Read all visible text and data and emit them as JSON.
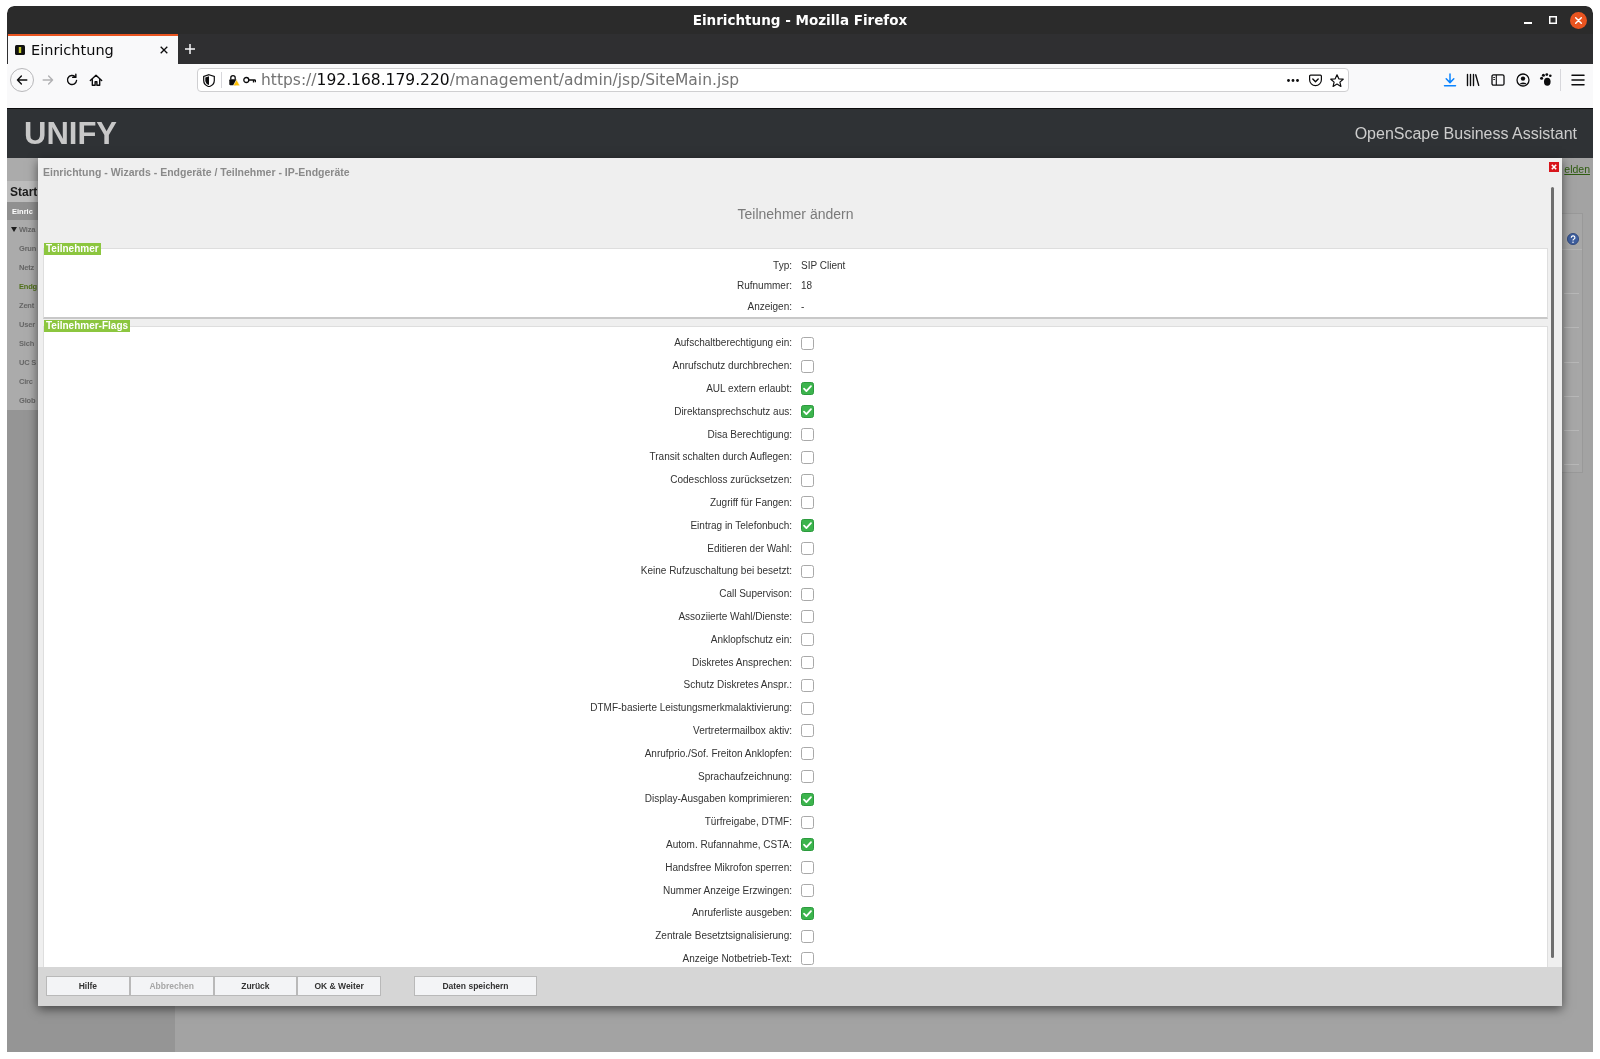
{
  "browser": {
    "window_title": "Einrichtung - Mozilla Firefox",
    "tabs": [
      {
        "title": "Einrichtung",
        "selected": true
      }
    ],
    "nav_buttons": [
      {
        "kind": "back",
        "disabled": false
      },
      {
        "kind": "forward",
        "disabled": true
      },
      {
        "kind": "reload",
        "disabled": false
      },
      {
        "kind": "home",
        "disabled": false
      }
    ],
    "url": {
      "scheme": "https://",
      "host": "192.168.179.220",
      "path": "/management/admin/jsp/SiteMain.jsp"
    }
  },
  "header": {
    "logo": "UNIFY",
    "product": "OpenScape Business Assistant"
  },
  "background": {
    "sidebar": {
      "tab": "Start",
      "section": "Einric",
      "group": {
        "label": "Wiza",
        "expanded": true,
        "children": [
          {
            "label": "Grun",
            "selected": false
          },
          {
            "label": "Netz",
            "selected": false
          },
          {
            "label": "Endg",
            "selected": true
          },
          {
            "label": "Zent",
            "selected": false
          },
          {
            "label": "User",
            "selected": false
          },
          {
            "label": "Sich",
            "selected": false
          },
          {
            "label": "UC S",
            "selected": false
          },
          {
            "label": "Circ",
            "selected": false
          },
          {
            "label": "Glob",
            "selected": false
          }
        ]
      }
    },
    "header_link": "elden"
  },
  "dialog": {
    "breadcrumb": "Einrichtung - Wizards - Endgeräte / Teilnehmer - IP-Endgeräte",
    "title": "Teilnehmer ändern",
    "sections": [
      {
        "kind": "info",
        "legend": "Teilnehmer",
        "rows": [
          {
            "label": "Typ:",
            "value": "SIP Client"
          },
          {
            "label": "Rufnummer:",
            "value": "18"
          },
          {
            "label": "Anzeigen:",
            "value": "-"
          }
        ]
      },
      {
        "kind": "flags",
        "legend": "Teilnehmer-Flags",
        "rows": [
          {
            "label": "Aufschaltberechtigung ein:",
            "checked": false
          },
          {
            "label": "Anrufschutz durchbrechen:",
            "checked": false
          },
          {
            "label": "AUL extern erlaubt:",
            "checked": true
          },
          {
            "label": "Direktansprechschutz aus:",
            "checked": true
          },
          {
            "label": "Disa Berechtigung:",
            "checked": false
          },
          {
            "label": "Transit schalten durch Auflegen:",
            "checked": false
          },
          {
            "label": "Codeschloss zurücksetzen:",
            "checked": false
          },
          {
            "label": "Zugriff für Fangen:",
            "checked": false
          },
          {
            "label": "Eintrag in Telefonbuch:",
            "checked": true
          },
          {
            "label": "Editieren der Wahl:",
            "checked": false
          },
          {
            "label": "Keine Rufzuschaltung bei besetzt:",
            "checked": false
          },
          {
            "label": "Call Supervison:",
            "checked": false
          },
          {
            "label": "Assoziierte Wahl/Dienste:",
            "checked": false
          },
          {
            "label": "Anklopfschutz ein:",
            "checked": false
          },
          {
            "label": "Diskretes Ansprechen:",
            "checked": false
          },
          {
            "label": "Schutz Diskretes Anspr.:",
            "checked": false
          },
          {
            "label": "DTMF-basierte Leistungsmerkmalaktivierung:",
            "checked": false
          },
          {
            "label": "Vertretermailbox aktiv:",
            "checked": false
          },
          {
            "label": "Anrufprio./Sof. Freiton Anklopfen:",
            "checked": false
          },
          {
            "label": "Sprachaufzeichnung:",
            "checked": false
          },
          {
            "label": "Display-Ausgaben komprimieren:",
            "checked": true
          },
          {
            "label": "Türfreigabe, DTMF:",
            "checked": false
          },
          {
            "label": "Autom. Rufannahme, CSTA:",
            "checked": true
          },
          {
            "label": "Handsfree Mikrofon sperren:",
            "checked": false
          },
          {
            "label": "Nummer Anzeige Erzwingen:",
            "checked": false
          },
          {
            "label": "Anruferliste ausgeben:",
            "checked": true
          },
          {
            "label": "Zentrale Besetztsignalisierung:",
            "checked": false
          },
          {
            "label": "Anzeige Notbetrieb-Text:",
            "checked": false
          }
        ]
      }
    ],
    "buttons": [
      {
        "label": "Hilfe",
        "disabled": false
      },
      {
        "label": "Abbrechen",
        "disabled": true
      },
      {
        "label": "Zurück",
        "disabled": false
      },
      {
        "label": "OK & Weiter",
        "disabled": false
      }
    ],
    "save_button": {
      "label": "Daten speichern",
      "disabled": false
    }
  }
}
